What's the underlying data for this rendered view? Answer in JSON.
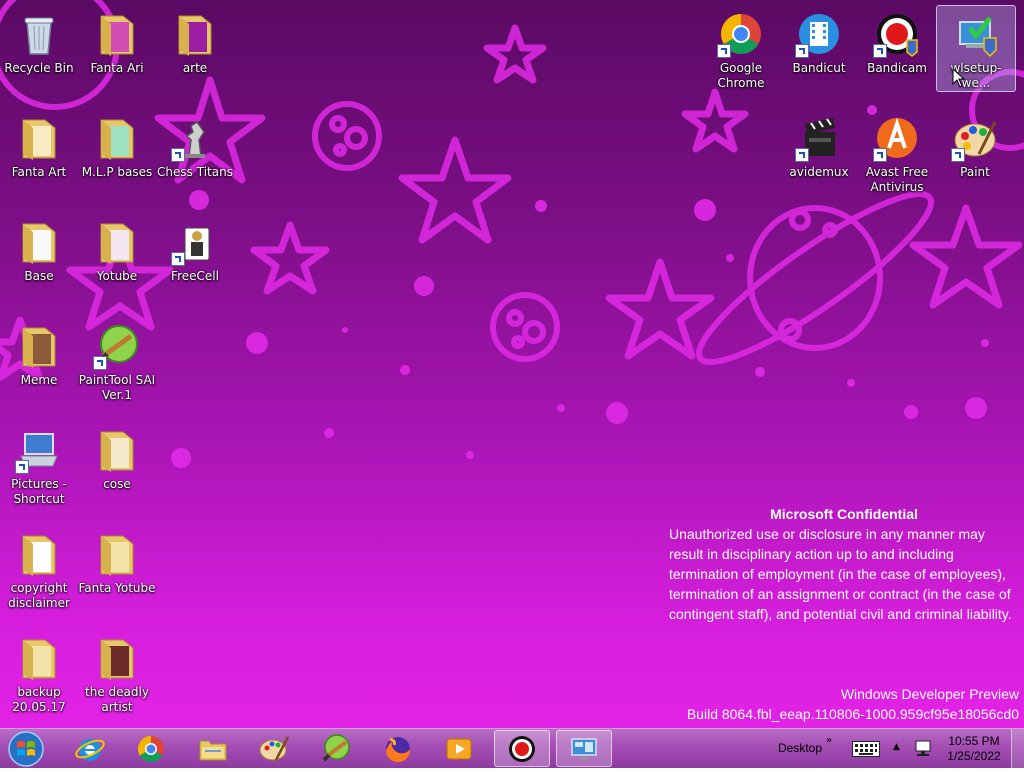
{
  "desktop_icons": [
    {
      "id": "recycle",
      "label": "Recycle Bin",
      "icon": "recycle-bin-icon"
    },
    {
      "id": "fanta-ari",
      "label": "Fanta Ari",
      "icon": "folder-icon"
    },
    {
      "id": "arte",
      "label": "arte",
      "icon": "folder-icon"
    },
    {
      "id": "fanta-art",
      "label": "Fanta Art",
      "icon": "folder-icon"
    },
    {
      "id": "mlp",
      "label": "M.L.P bases",
      "icon": "folder-icon"
    },
    {
      "id": "chess",
      "label": "Chess Titans",
      "icon": "chess-icon"
    },
    {
      "id": "base",
      "label": "Base",
      "icon": "folder-icon"
    },
    {
      "id": "yotube",
      "label": "Yotube",
      "icon": "folder-icon"
    },
    {
      "id": "freecell",
      "label": "FreeCell",
      "icon": "freecell-icon"
    },
    {
      "id": "meme",
      "label": "Meme",
      "icon": "folder-icon"
    },
    {
      "id": "sai",
      "label": "PaintTool SAI Ver.1",
      "icon": "painttool-sai-icon"
    },
    {
      "id": "pictures",
      "label": "Pictures - Shortcut",
      "icon": "pictures-shortcut-icon"
    },
    {
      "id": "cose",
      "label": "cose",
      "icon": "folder-icon"
    },
    {
      "id": "copyright",
      "label": "copyright disclaimer",
      "icon": "folder-icon"
    },
    {
      "id": "fanta-yotube",
      "label": "Fanta Yotube",
      "icon": "folder-icon"
    },
    {
      "id": "backup",
      "label": "backup 20.05.17",
      "icon": "folder-icon"
    },
    {
      "id": "deadly",
      "label": "the deadly artist",
      "icon": "folder-icon"
    },
    {
      "id": "chrome",
      "label": "Google Chrome",
      "icon": "chrome-icon"
    },
    {
      "id": "bandicut",
      "label": "Bandicut",
      "icon": "bandicut-icon"
    },
    {
      "id": "bandicam",
      "label": "Bandicam",
      "icon": "bandicam-icon"
    },
    {
      "id": "wlsetup",
      "label": "wlsetup-we...",
      "icon": "setup-icon"
    },
    {
      "id": "avidemux",
      "label": "avidemux",
      "icon": "avidemux-icon"
    },
    {
      "id": "avast",
      "label": "Avast Free Antivirus",
      "icon": "avast-icon"
    },
    {
      "id": "paint",
      "label": "Paint",
      "icon": "paint-icon"
    }
  ],
  "confidential": {
    "title": "Microsoft Confidential",
    "body": "Unauthorized use or disclosure in any manner may result in disciplinary action up to and including termination of employment (in the case of employees), termination of an assignment or contract (in the case of contingent staff), and potential civil and criminal liability."
  },
  "build": {
    "line1": "Windows Developer Preview",
    "line2": "Build 8064.fbl_eeap.110806-1000.959cf95e18056cd0"
  },
  "taskbar": {
    "pinned": [
      "internet-explorer-icon",
      "chrome-icon",
      "file-explorer-icon",
      "paint-icon",
      "painttool-sai-icon",
      "firefox-icon",
      "media-player-icon",
      "bandicam-icon",
      "remote-desktop-icon"
    ],
    "active": [
      "bandicam-icon",
      "remote-desktop-icon"
    ],
    "toolbar_label": "Desktop",
    "clock_time": "10:55 PM",
    "clock_date": "1/25/2022"
  },
  "colors": {
    "wallpaper_top": "#5a0a63",
    "wallpaper_bottom": "#e223e6",
    "taskbar": "#a650b6",
    "decoration": "#e02ae6"
  }
}
